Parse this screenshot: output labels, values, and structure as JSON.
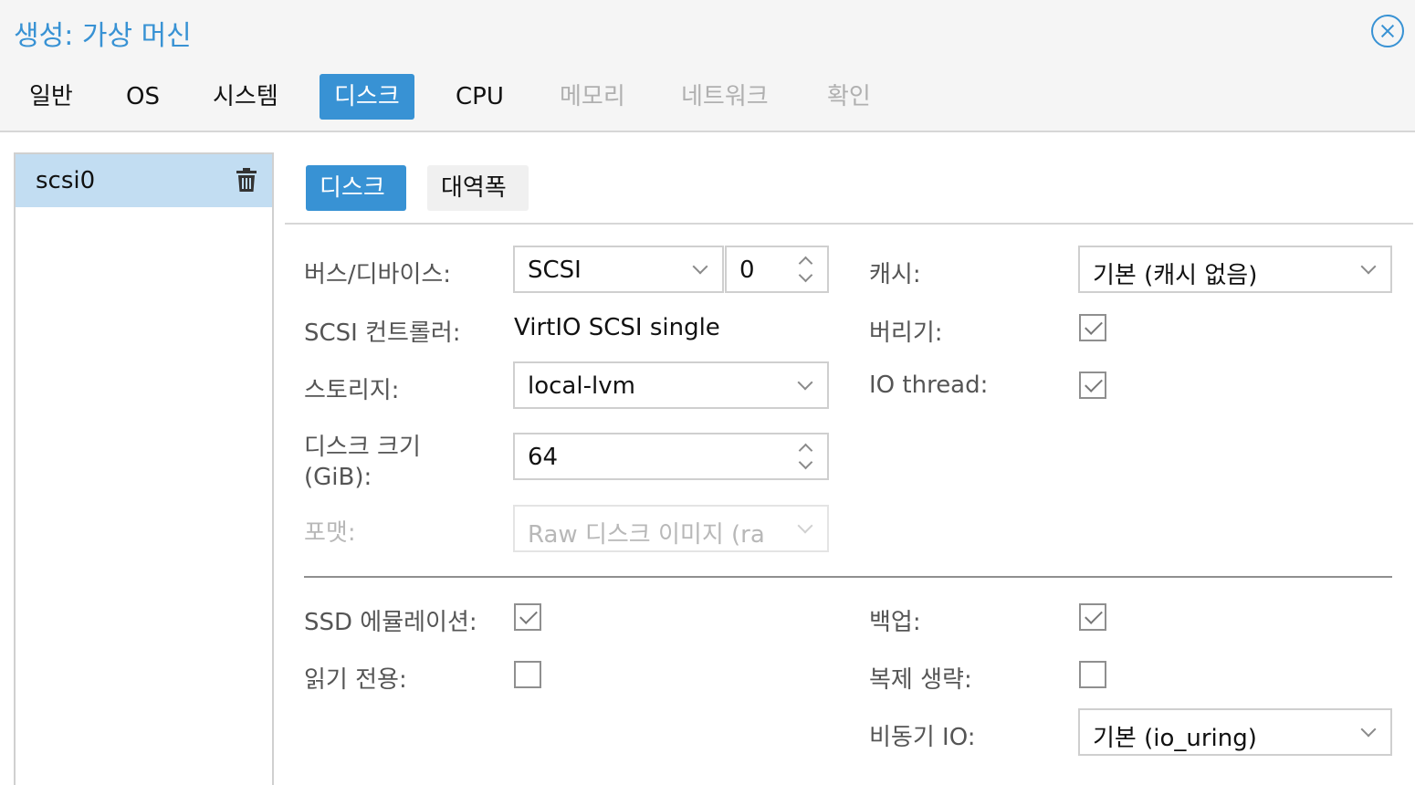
{
  "window": {
    "title": "생성: 가상 머신"
  },
  "tabs": [
    {
      "label": "일반",
      "state": "normal"
    },
    {
      "label": "OS",
      "state": "normal"
    },
    {
      "label": "시스템",
      "state": "normal"
    },
    {
      "label": "디스크",
      "state": "active"
    },
    {
      "label": "CPU",
      "state": "normal"
    },
    {
      "label": "메모리",
      "state": "disabled"
    },
    {
      "label": "네트워크",
      "state": "disabled"
    },
    {
      "label": "확인",
      "state": "disabled"
    }
  ],
  "disk_list": {
    "items": [
      {
        "label": "scsi0",
        "selected": true
      }
    ]
  },
  "subtabs": [
    {
      "label": "디스크",
      "active": true
    },
    {
      "label": "대역폭",
      "active": false
    }
  ],
  "form": {
    "bus_device": {
      "label": "버스/디바이스:",
      "bus_value": "SCSI",
      "device_value": "0"
    },
    "scsi_controller": {
      "label": "SCSI 컨트롤러:",
      "value": "VirtIO SCSI single"
    },
    "storage": {
      "label": "스토리지:",
      "value": "local-lvm"
    },
    "disk_size": {
      "label_line1": "디스크 크기",
      "label_line2": "(GiB):",
      "value": "64"
    },
    "format": {
      "label": "포맷:",
      "value": "Raw 디스크 이미지 (ra",
      "disabled": true
    },
    "cache": {
      "label": "캐시:",
      "value": "기본 (캐시 없음)"
    },
    "discard": {
      "label": "버리기:",
      "checked": true
    },
    "io_thread": {
      "label": "IO thread:",
      "checked": true
    },
    "ssd_emulation": {
      "label": "SSD 에뮬레이션:",
      "checked": true
    },
    "read_only": {
      "label": "읽기 전용:",
      "checked": false
    },
    "backup": {
      "label": "백업:",
      "checked": true
    },
    "skip_replication": {
      "label": "복제 생략:",
      "checked": false
    },
    "async_io": {
      "label": "비동기 IO:",
      "value": "기본 (io_uring)"
    }
  },
  "colors": {
    "accent": "#3892d4",
    "selected_row": "#c2ddf2",
    "header_bg": "#f5f5f5"
  }
}
